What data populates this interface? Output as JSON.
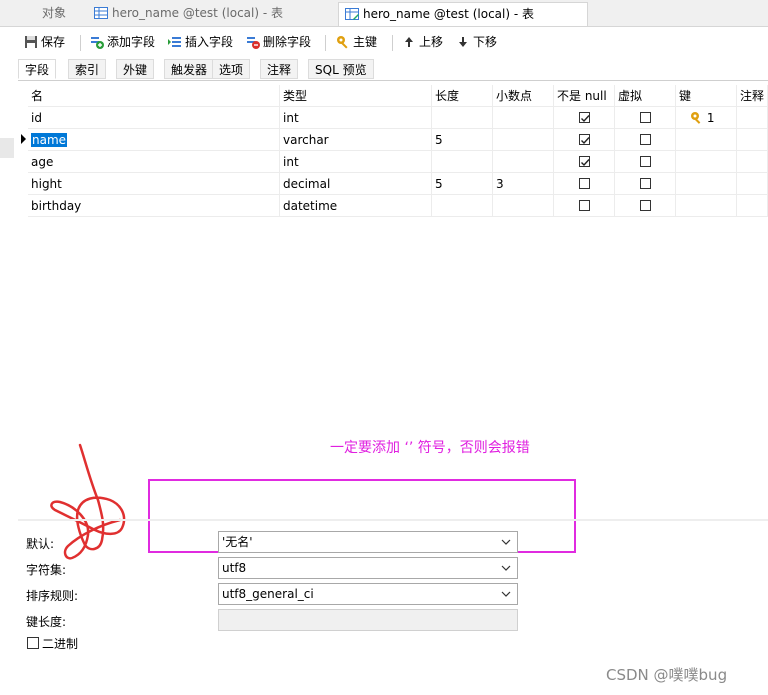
{
  "window_tabs": [
    {
      "label": "对象",
      "active": false
    },
    {
      "label": "hero_name @test (local) - 表",
      "active": false
    },
    {
      "label": "hero_name @test (local) - 表",
      "active": true
    }
  ],
  "toolbar": {
    "save": "保存",
    "add_field": "添加字段",
    "insert_field": "插入字段",
    "delete_field": "删除字段",
    "primary_key": "主键",
    "move_up": "上移",
    "move_down": "下移"
  },
  "sub_tabs": [
    "字段",
    "索引",
    "外键",
    "触发器",
    "选项",
    "注释",
    "SQL 预览"
  ],
  "columns": [
    "名",
    "类型",
    "长度",
    "小数点",
    "不是 null",
    "虚拟",
    "键",
    "注释"
  ],
  "rows": [
    {
      "name": "id",
      "type": "int",
      "length": "",
      "decimals": "",
      "not_null": true,
      "virtual": false,
      "key": "1",
      "comment": ""
    },
    {
      "name": "name",
      "type": "varchar",
      "length": "5",
      "decimals": "",
      "not_null": true,
      "virtual": false,
      "key": "",
      "comment": ""
    },
    {
      "name": "age",
      "type": "int",
      "length": "",
      "decimals": "",
      "not_null": true,
      "virtual": false,
      "key": "",
      "comment": ""
    },
    {
      "name": "hight",
      "type": "decimal",
      "length": "5",
      "decimals": "3",
      "not_null": false,
      "virtual": false,
      "key": "",
      "comment": ""
    },
    {
      "name": "birthday",
      "type": "datetime",
      "length": "",
      "decimals": "",
      "not_null": false,
      "virtual": false,
      "key": "",
      "comment": ""
    }
  ],
  "annotation": {
    "note": "一定要添加 ‘’ 符号，否则会报错",
    "color": "#e020e0"
  },
  "properties": {
    "default_label": "默认:",
    "default_value": "'无名'",
    "charset_label": "字符集:",
    "charset_value": "utf8",
    "collation_label": "排序规则:",
    "collation_value": "utf8_general_ci",
    "key_length_label": "键长度:",
    "key_length_value": "",
    "binary_label": "二进制",
    "binary_checked": false
  },
  "watermark": "CSDN @噗噗bug"
}
